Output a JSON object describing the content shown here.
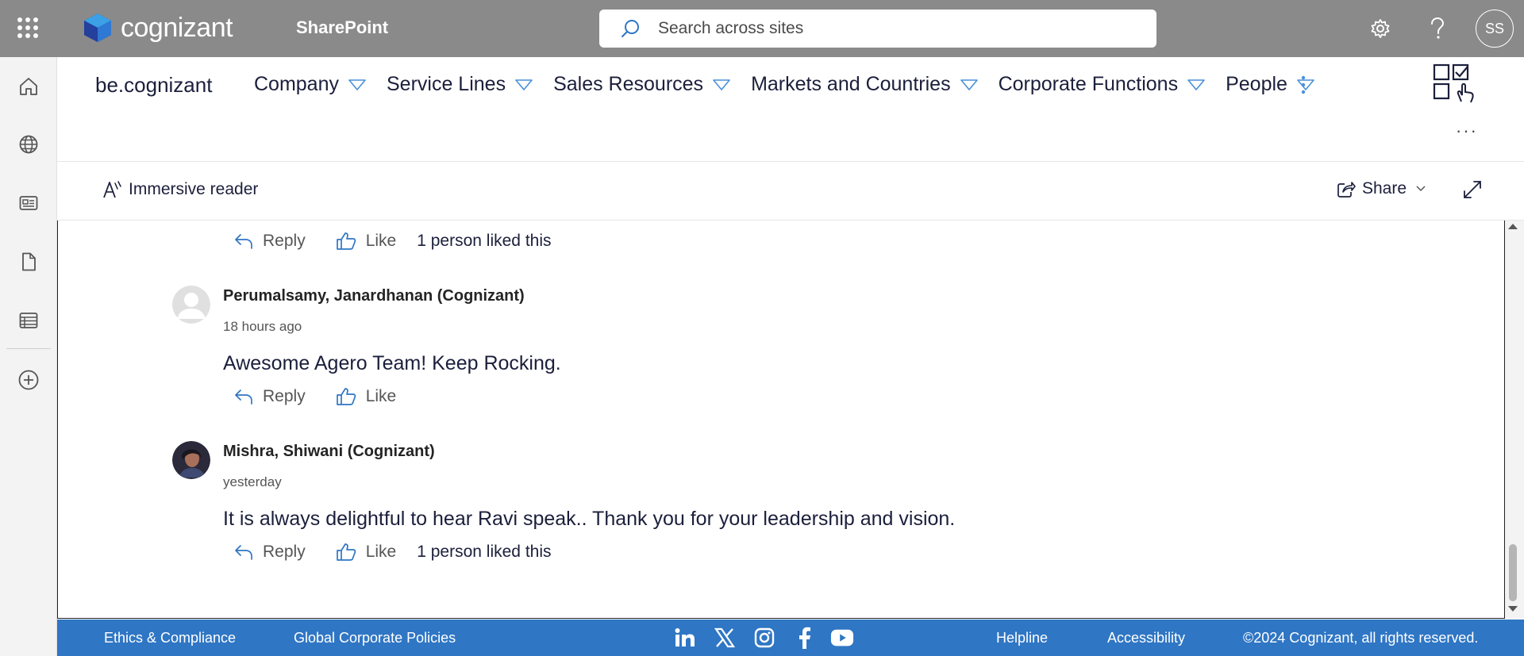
{
  "suitebar": {
    "logo_text": "cognizant",
    "app_name": "SharePoint",
    "search_placeholder": "Search across sites",
    "avatar_initials": "SS",
    "icons": [
      "waffle-icon",
      "settings-icon",
      "help-icon"
    ]
  },
  "appbar": {
    "items": [
      "home-icon",
      "globe-icon",
      "news-icon",
      "document-icon",
      "list-icon",
      "add-icon"
    ]
  },
  "site": {
    "title": "be.cognizant",
    "nav": [
      "Company",
      "Service Lines",
      "Sales Resources",
      "Markets and Countries",
      "Corporate Functions",
      "People"
    ]
  },
  "commandbar": {
    "immersive_reader": "Immersive reader",
    "share": "Share"
  },
  "comments": {
    "reply_label": "Reply",
    "like_label": "Like",
    "prev_liked": "1 person liked this",
    "items": [
      {
        "author": "Perumalsamy, Janardhanan (Cognizant)",
        "time": "18 hours ago",
        "text": "Awesome Agero Team! Keep Rocking.",
        "liked": ""
      },
      {
        "author": "Mishra, Shiwani (Cognizant)",
        "time": "yesterday",
        "text": "It is always delightful to hear Ravi speak.. Thank you for your leadership and vision.",
        "liked": "1 person liked this"
      }
    ]
  },
  "footer": {
    "links": [
      "Ethics & Compliance",
      "Global Corporate Policies",
      "Helpline",
      "Accessibility"
    ],
    "social": [
      "linkedin-icon",
      "x-icon",
      "instagram-icon",
      "facebook-icon",
      "youtube-icon"
    ],
    "copyright": "©2024 Cognizant, all rights reserved."
  },
  "colors": {
    "suitebar": "#8a8a8a",
    "footer": "#2f76c4",
    "nav_text": "#1b1f3b",
    "icon_blue": "#2f76c4"
  }
}
